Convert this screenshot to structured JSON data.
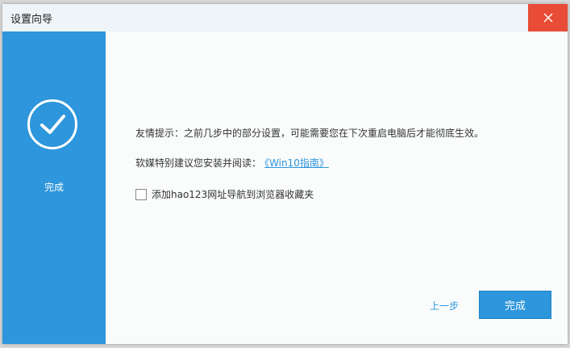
{
  "window": {
    "title": "设置向导",
    "close_label": "X"
  },
  "sidebar": {
    "step_label": "完成"
  },
  "main": {
    "tip": "友情提示：之前几步中的部分设置，可能需要您在下次重启电脑后才能彻底生效。",
    "recommend": "软媒特别建议您安装并阅读：",
    "recommend_link": "《Win10指南》",
    "checkbox_label": "添加hao123网址导航到浏览器收藏夹",
    "checkbox_checked": false
  },
  "footer": {
    "prev_label": "上一步",
    "finish_label": "完成"
  }
}
